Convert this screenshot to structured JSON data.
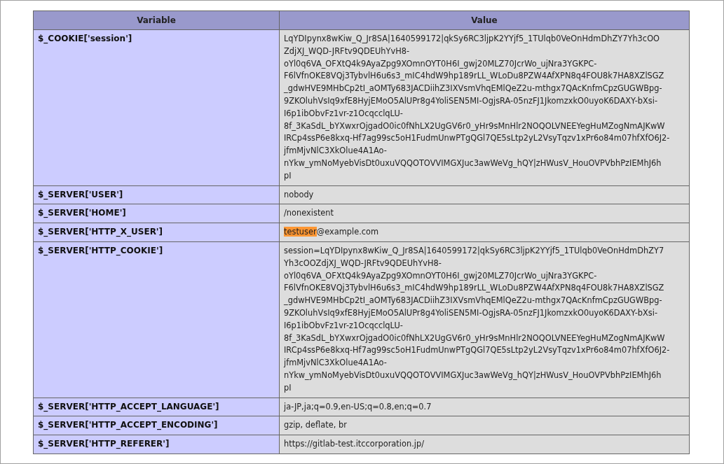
{
  "table": {
    "columns": [
      "Variable",
      "Value"
    ],
    "rows": [
      {
        "variable": "$_COOKIE['session']",
        "lines": [
          "LqYDIpynx8wKiw_Q_Jr8SA|1640599172|qkSy6RC3ljpK2YYjf5_1TUlqb0VeOnHdmDhZY7Yh3cOO",
          "ZdjXJ_WQD-JRFtv9QDEUhYvH8-",
          "oYl0q6VA_OFXtQ4k9AyaZpg9XOmnOYT0H6I_gwj20MLZ70JcrWo_ujNra3YGKPC-",
          "F6lVfnOKE8VQj3TybvlH6u6s3_mIC4hdW9hp189rLL_WLoDu8PZW4AfXPN8q4FOU8k7HA8XZlSGZ",
          "_gdwHVE9MHbCp2tI_aOMTy683JACDiihZ3IXVsmVhqEMlQeZ2u-mthgx7QAcKnfmCpzGUGWBpg-",
          "9ZKOluhVsIq9xfE8HyjEMoO5AlUPr8g4YoliSEN5MI-OgjsRA-05nzFJ1JkomzxkO0uyoK6DAXY-bXsi-",
          "I6p1ibObvFz1vr-z1OcqcclqLU-",
          "8f_3KaSdL_bYXwxrOjgadO0ic0fNhLX2UgGV6r0_yHr9sMnHlr2NOQOLVNEEYegHuMZogNmAJKwW",
          "IRCp4ssP6e8kxq-Hf7ag99sc5oH1FudmUnwPTgQGl7QE5sLtp2yL2VsyTqzv1xPr6o84m07hfXfO6J2-",
          "jfmMjvNlC3XkOlue4A1Ao-",
          "nYkw_ymNoMyebVisDt0uxuVQQOTOVVIMGXJuc3awWeVg_hQY|zHWusV_HouOVPVbhPzIEMhJ6h",
          "pI"
        ]
      },
      {
        "variable": "$_SERVER['USER']",
        "lines": [
          "nobody"
        ]
      },
      {
        "variable": "$_SERVER['HOME']",
        "lines": [
          "/nonexistent"
        ]
      },
      {
        "variable": "$_SERVER['HTTP_X_USER']",
        "parts": [
          {
            "text": "testuser",
            "highlighted": true
          },
          {
            "text": "@example.com",
            "highlighted": false
          }
        ]
      },
      {
        "variable": "$_SERVER['HTTP_COOKIE']",
        "lines": [
          "session=LqYDIpynx8wKiw_Q_Jr8SA|1640599172|qkSy6RC3ljpK2YYjf5_1TUlqb0VeOnHdmDhZY7",
          "Yh3cOOZdjXJ_WQD-JRFtv9QDEUhYvH8-",
          "oYl0q6VA_OFXtQ4k9AyaZpg9XOmnOYT0H6I_gwj20MLZ70JcrWo_ujNra3YGKPC-",
          "F6lVfnOKE8VQj3TybvlH6u6s3_mIC4hdW9hp189rLL_WLoDu8PZW4AfXPN8q4FOU8k7HA8XZlSGZ",
          "_gdwHVE9MHbCp2tI_aOMTy683JACDiihZ3IXVsmVhqEMlQeZ2u-mthgx7QAcKnfmCpzGUGWBpg-",
          "9ZKOluhVsIq9xfE8HyjEMoO5AlUPr8g4YoliSEN5MI-OgjsRA-05nzFJ1JkomzxkO0uyoK6DAXY-bXsi-",
          "I6p1ibObvFz1vr-z1OcqcclqLU-",
          "8f_3KaSdL_bYXwxrOjgadO0ic0fNhLX2UgGV6r0_yHr9sMnHlr2NOQOLVNEEYegHuMZogNmAJKwW",
          "IRCp4ssP6e8kxq-Hf7ag99sc5oH1FudmUnwPTgQGl7QE5sLtp2yL2VsyTqzv1xPr6o84m07hfXfO6J2-",
          "jfmMjvNlC3XkOlue4A1Ao-",
          "nYkw_ymNoMyebVisDt0uxuVQQOTOVVIMGXJuc3awWeVg_hQY|zHWusV_HouOVPVbhPzIEMhJ6h",
          "pI"
        ]
      },
      {
        "variable": "$_SERVER['HTTP_ACCEPT_LANGUAGE']",
        "lines": [
          "ja-JP,ja;q=0.9,en-US;q=0.8,en;q=0.7"
        ]
      },
      {
        "variable": "$_SERVER['HTTP_ACCEPT_ENCODING']",
        "lines": [
          "gzip, deflate, br"
        ]
      },
      {
        "variable": "$_SERVER['HTTP_REFERER']",
        "lines": [
          "https://gitlab-test.itccorporation.jp/"
        ]
      }
    ]
  }
}
